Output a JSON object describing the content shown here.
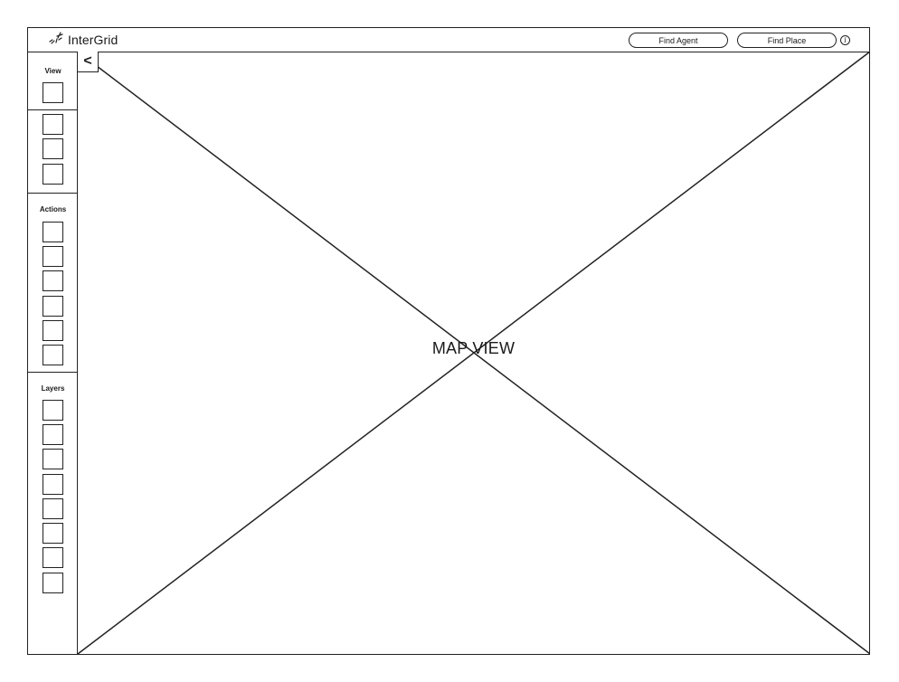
{
  "header": {
    "brand_name": "InterGrid",
    "find_agent_label": "Find Agent",
    "find_place_label": "Find Place",
    "info_glyph": "i"
  },
  "sidebar": {
    "collapse_glyph": "<",
    "sections": [
      {
        "label": "View",
        "button_count": 1
      },
      {
        "label": "",
        "button_count": 3
      },
      {
        "label": "Actions",
        "button_count": 6
      },
      {
        "label": "Layers",
        "button_count": 8
      }
    ]
  },
  "map": {
    "placeholder_label": "MAP VIEW"
  },
  "icons": {
    "logo": "sparkle-logo-icon",
    "info": "info-icon",
    "collapse": "chevron-left-icon"
  }
}
